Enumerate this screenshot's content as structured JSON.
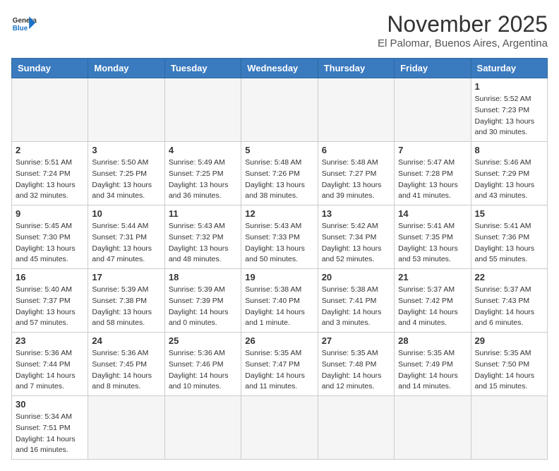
{
  "header": {
    "logo_general": "General",
    "logo_blue": "Blue",
    "month": "November 2025",
    "location": "El Palomar, Buenos Aires, Argentina"
  },
  "weekdays": [
    "Sunday",
    "Monday",
    "Tuesday",
    "Wednesday",
    "Thursday",
    "Friday",
    "Saturday"
  ],
  "weeks": [
    [
      {
        "day": "",
        "info": ""
      },
      {
        "day": "",
        "info": ""
      },
      {
        "day": "",
        "info": ""
      },
      {
        "day": "",
        "info": ""
      },
      {
        "day": "",
        "info": ""
      },
      {
        "day": "",
        "info": ""
      },
      {
        "day": "1",
        "info": "Sunrise: 5:52 AM\nSunset: 7:23 PM\nDaylight: 13 hours and 30 minutes."
      }
    ],
    [
      {
        "day": "2",
        "info": "Sunrise: 5:51 AM\nSunset: 7:24 PM\nDaylight: 13 hours and 32 minutes."
      },
      {
        "day": "3",
        "info": "Sunrise: 5:50 AM\nSunset: 7:25 PM\nDaylight: 13 hours and 34 minutes."
      },
      {
        "day": "4",
        "info": "Sunrise: 5:49 AM\nSunset: 7:25 PM\nDaylight: 13 hours and 36 minutes."
      },
      {
        "day": "5",
        "info": "Sunrise: 5:48 AM\nSunset: 7:26 PM\nDaylight: 13 hours and 38 minutes."
      },
      {
        "day": "6",
        "info": "Sunrise: 5:48 AM\nSunset: 7:27 PM\nDaylight: 13 hours and 39 minutes."
      },
      {
        "day": "7",
        "info": "Sunrise: 5:47 AM\nSunset: 7:28 PM\nDaylight: 13 hours and 41 minutes."
      },
      {
        "day": "8",
        "info": "Sunrise: 5:46 AM\nSunset: 7:29 PM\nDaylight: 13 hours and 43 minutes."
      }
    ],
    [
      {
        "day": "9",
        "info": "Sunrise: 5:45 AM\nSunset: 7:30 PM\nDaylight: 13 hours and 45 minutes."
      },
      {
        "day": "10",
        "info": "Sunrise: 5:44 AM\nSunset: 7:31 PM\nDaylight: 13 hours and 47 minutes."
      },
      {
        "day": "11",
        "info": "Sunrise: 5:43 AM\nSunset: 7:32 PM\nDaylight: 13 hours and 48 minutes."
      },
      {
        "day": "12",
        "info": "Sunrise: 5:43 AM\nSunset: 7:33 PM\nDaylight: 13 hours and 50 minutes."
      },
      {
        "day": "13",
        "info": "Sunrise: 5:42 AM\nSunset: 7:34 PM\nDaylight: 13 hours and 52 minutes."
      },
      {
        "day": "14",
        "info": "Sunrise: 5:41 AM\nSunset: 7:35 PM\nDaylight: 13 hours and 53 minutes."
      },
      {
        "day": "15",
        "info": "Sunrise: 5:41 AM\nSunset: 7:36 PM\nDaylight: 13 hours and 55 minutes."
      }
    ],
    [
      {
        "day": "16",
        "info": "Sunrise: 5:40 AM\nSunset: 7:37 PM\nDaylight: 13 hours and 57 minutes."
      },
      {
        "day": "17",
        "info": "Sunrise: 5:39 AM\nSunset: 7:38 PM\nDaylight: 13 hours and 58 minutes."
      },
      {
        "day": "18",
        "info": "Sunrise: 5:39 AM\nSunset: 7:39 PM\nDaylight: 14 hours and 0 minutes."
      },
      {
        "day": "19",
        "info": "Sunrise: 5:38 AM\nSunset: 7:40 PM\nDaylight: 14 hours and 1 minute."
      },
      {
        "day": "20",
        "info": "Sunrise: 5:38 AM\nSunset: 7:41 PM\nDaylight: 14 hours and 3 minutes."
      },
      {
        "day": "21",
        "info": "Sunrise: 5:37 AM\nSunset: 7:42 PM\nDaylight: 14 hours and 4 minutes."
      },
      {
        "day": "22",
        "info": "Sunrise: 5:37 AM\nSunset: 7:43 PM\nDaylight: 14 hours and 6 minutes."
      }
    ],
    [
      {
        "day": "23",
        "info": "Sunrise: 5:36 AM\nSunset: 7:44 PM\nDaylight: 14 hours and 7 minutes."
      },
      {
        "day": "24",
        "info": "Sunrise: 5:36 AM\nSunset: 7:45 PM\nDaylight: 14 hours and 8 minutes."
      },
      {
        "day": "25",
        "info": "Sunrise: 5:36 AM\nSunset: 7:46 PM\nDaylight: 14 hours and 10 minutes."
      },
      {
        "day": "26",
        "info": "Sunrise: 5:35 AM\nSunset: 7:47 PM\nDaylight: 14 hours and 11 minutes."
      },
      {
        "day": "27",
        "info": "Sunrise: 5:35 AM\nSunset: 7:48 PM\nDaylight: 14 hours and 12 minutes."
      },
      {
        "day": "28",
        "info": "Sunrise: 5:35 AM\nSunset: 7:49 PM\nDaylight: 14 hours and 14 minutes."
      },
      {
        "day": "29",
        "info": "Sunrise: 5:35 AM\nSunset: 7:50 PM\nDaylight: 14 hours and 15 minutes."
      }
    ],
    [
      {
        "day": "30",
        "info": "Sunrise: 5:34 AM\nSunset: 7:51 PM\nDaylight: 14 hours and 16 minutes."
      },
      {
        "day": "",
        "info": ""
      },
      {
        "day": "",
        "info": ""
      },
      {
        "day": "",
        "info": ""
      },
      {
        "day": "",
        "info": ""
      },
      {
        "day": "",
        "info": ""
      },
      {
        "day": "",
        "info": ""
      }
    ]
  ]
}
